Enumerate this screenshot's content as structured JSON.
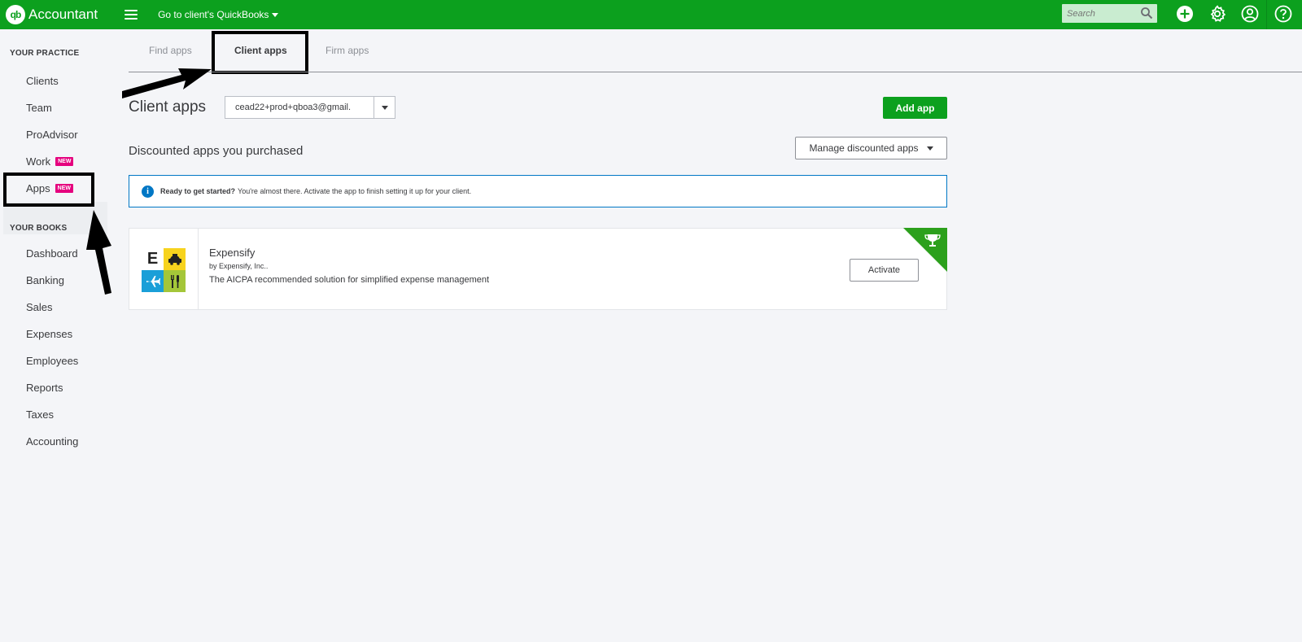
{
  "topbar": {
    "logo_text": "qb",
    "brand": "Accountant",
    "client_switch": "Go to client's QuickBooks",
    "search_placeholder": "Search"
  },
  "sidebar": {
    "practice_heading": "YOUR PRACTICE",
    "practice_items": [
      {
        "label": "Clients"
      },
      {
        "label": "Team"
      },
      {
        "label": "ProAdvisor"
      },
      {
        "label": "Work",
        "badge": "NEW"
      },
      {
        "label": "Apps",
        "badge": "NEW",
        "active": true
      }
    ],
    "books_heading": "YOUR BOOKS",
    "books_items": [
      {
        "label": "Dashboard"
      },
      {
        "label": "Banking"
      },
      {
        "label": "Sales"
      },
      {
        "label": "Expenses"
      },
      {
        "label": "Employees"
      },
      {
        "label": "Reports"
      },
      {
        "label": "Taxes"
      },
      {
        "label": "Accounting"
      }
    ]
  },
  "tabs": [
    {
      "label": "Find apps",
      "active": false
    },
    {
      "label": "Client apps",
      "active": true
    },
    {
      "label": "Firm apps",
      "active": false
    }
  ],
  "main": {
    "title": "Client apps",
    "client_select_value": "cead22+prod+qboa3@gmail.",
    "add_app_label": "Add app",
    "section_title": "Discounted apps you purchased",
    "manage_label": "Manage discounted apps",
    "banner_bold": "Ready to get started?",
    "banner_text": "You're almost there. Activate the app to finish setting it up for your client.",
    "info_glyph": "i"
  },
  "app": {
    "logo_letter": "E",
    "name": "Expensify",
    "vendor": "by Expensify, Inc..",
    "description": "The AICPA recommended solution for simplified expense management",
    "action_label": "Activate"
  },
  "colors": {
    "brand_green": "#0ca01e",
    "badge_pink": "#e5007e",
    "info_blue": "#0077c5",
    "ribbon_green": "#2ca01c"
  },
  "icons": {
    "menu": "hamburger-icon",
    "search": "search-icon",
    "create": "plus-circle-icon",
    "settings": "gear-icon",
    "account": "user-circle-icon",
    "help": "question-circle-icon",
    "award": "trophy-icon"
  }
}
